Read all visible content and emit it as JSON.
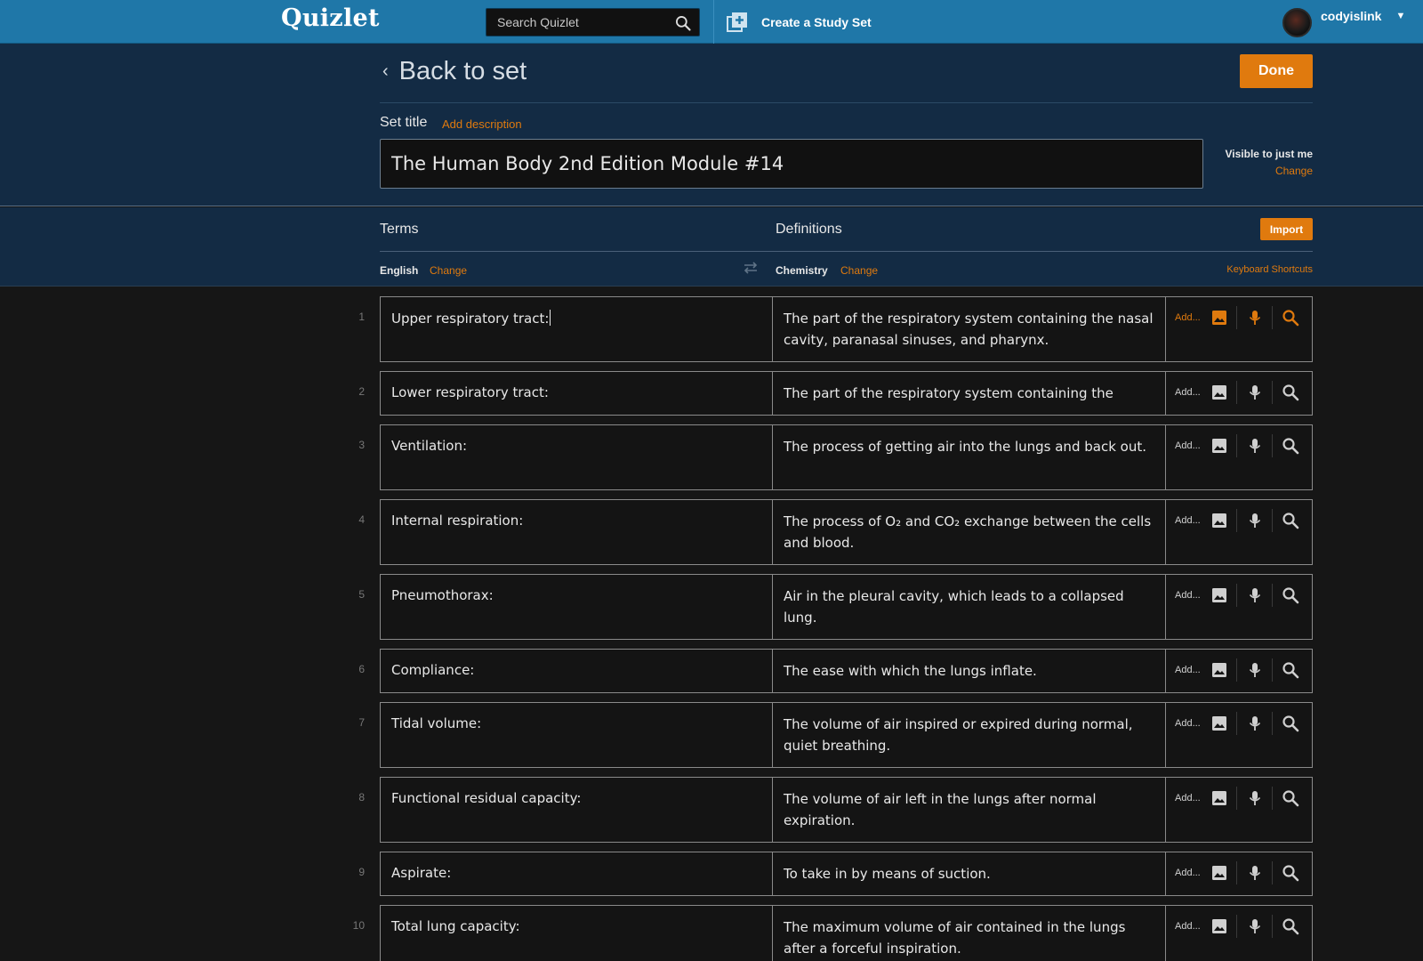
{
  "topbar": {
    "logo": "Quizlet",
    "search_placeholder": "Search Quizlet",
    "create_label": "Create a Study Set",
    "username": "codyislink"
  },
  "header": {
    "back_label": "Back to set",
    "done_label": "Done",
    "set_title_label": "Set title",
    "add_description": "Add description",
    "title_value": "The Human Body 2nd Edition Module #14",
    "visibility": "Visible to just me",
    "visibility_change": "Change"
  },
  "columns": {
    "terms": "Terms",
    "definitions": "Definitions",
    "import": "Import",
    "term_lang": "English",
    "term_lang_change": "Change",
    "def_lang": "Chemistry",
    "def_lang_change": "Change",
    "keyboard_shortcuts": "Keyboard Shortcuts"
  },
  "cards": [
    {
      "num": "1",
      "term": "Upper respiratory tract:",
      "def": "The part of the respiratory system containing the nasal cavity, paranasal sinuses, and pharynx.",
      "add": "Add..."
    },
    {
      "num": "2",
      "term": "Lower respiratory tract:",
      "def": "The part of the respiratory system containing the",
      "add": "Add..."
    },
    {
      "num": "3",
      "term": "Ventilation:",
      "def": "The process of getting air into the lungs and back out.",
      "add": "Add..."
    },
    {
      "num": "4",
      "term": "Internal respiration:",
      "def": "The process of O₂ and CO₂ exchange between the cells and blood.",
      "add": "Add..."
    },
    {
      "num": "5",
      "term": "Pneumothorax:",
      "def": "Air in the pleural cavity, which leads to a collapsed lung.",
      "add": "Add..."
    },
    {
      "num": "6",
      "term": "Compliance:",
      "def": "The ease with which the lungs inflate.",
      "add": "Add..."
    },
    {
      "num": "7",
      "term": "Tidal volume:",
      "def": "The volume of air inspired or expired during normal, quiet breathing.",
      "add": "Add..."
    },
    {
      "num": "8",
      "term": "Functional residual capacity:",
      "def": "The volume of air left in the lungs after normal expiration.",
      "add": "Add..."
    },
    {
      "num": "9",
      "term": "Aspirate:",
      "def": "To take in by means of suction.",
      "add": "Add..."
    },
    {
      "num": "10",
      "term": "Total lung capacity:",
      "def": "The maximum volume of air contained in the lungs after a forceful inspiration.",
      "add": "Add..."
    }
  ],
  "colors": {
    "accent": "#e07a0e",
    "topbar": "#1f77a8",
    "header": "#132b44",
    "background": "#161616"
  }
}
